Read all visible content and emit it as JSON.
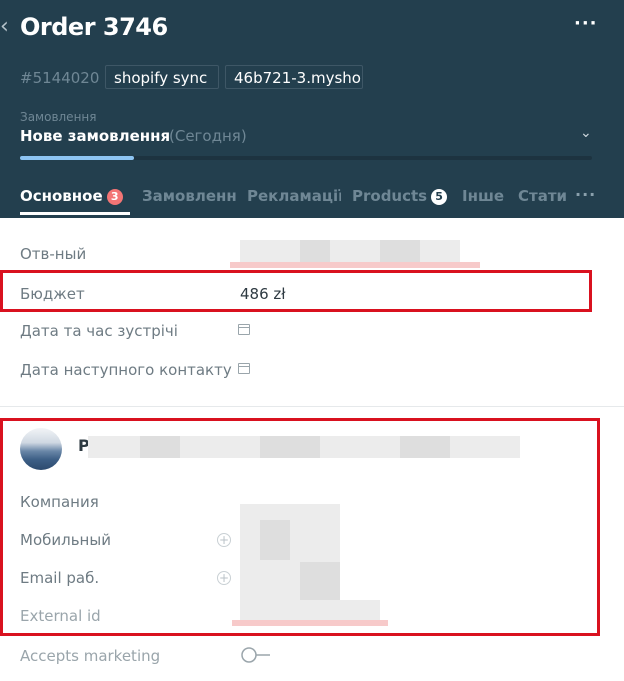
{
  "header": {
    "title": "Order 3746",
    "order_id": "#5144020",
    "tags": [
      "shopify sync",
      "46b721-3.mysho"
    ],
    "pipeline_label": "Замовлення",
    "status_name": "Нове замовлення",
    "status_date": "(Сегодня)",
    "progress_percent": 20
  },
  "tabs": [
    {
      "label": "Основное",
      "badge": "3",
      "active": true
    },
    {
      "label": "Замовленн",
      "badge": null,
      "active": false
    },
    {
      "label": "Рекламації",
      "badge": null,
      "active": false
    },
    {
      "label": "Products",
      "badge": "5",
      "active": false
    },
    {
      "label": "Інше",
      "badge": null,
      "active": false
    },
    {
      "label": "Статистика",
      "badge": null,
      "active": false
    }
  ],
  "fields": {
    "responsible_label": "Отв-ный",
    "budget_label": "Бюджет",
    "budget_value": "486 zł",
    "meeting_label": "Дата та час зустрічі",
    "next_contact_label": "Дата наступного контакту"
  },
  "contact": {
    "initial": "P",
    "company_label": "Компания",
    "mobile_label": "Мобильный",
    "email_label": "Email раб.",
    "external_id_label": "External id",
    "accepts_marketing_label": "Accepts marketing"
  },
  "colors": {
    "header_bg": "#233f4e",
    "accent_progress": "#8dc4f2",
    "badge_red": "#f37575",
    "highlight_red": "#d9111f"
  }
}
